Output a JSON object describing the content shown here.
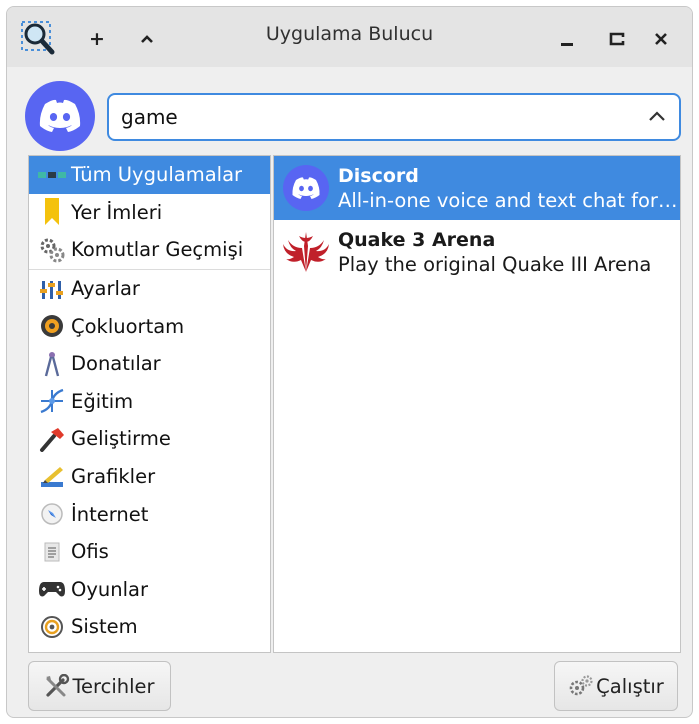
{
  "window": {
    "title": "Uygulama Bulucu",
    "new_label": "+",
    "collapse_label": "^",
    "minimize_label": "_",
    "maximize_label": "▭",
    "close_label": "✕"
  },
  "search": {
    "value": "game",
    "avatar_icon": "discord-icon",
    "toggle_icon": "chevron-up-icon"
  },
  "categories": [
    {
      "label": "Tüm Uygulamalar",
      "icon": "all-apps-icon",
      "selected": true
    },
    {
      "label": "Yer İmleri",
      "icon": "bookmark-icon"
    },
    {
      "label": "Komutlar Geçmişi",
      "icon": "gears-icon"
    },
    {
      "label": "Ayarlar",
      "icon": "sliders-icon"
    },
    {
      "label": "Çokluortam",
      "icon": "multimedia-icon"
    },
    {
      "label": "Donatılar",
      "icon": "compass-icon"
    },
    {
      "label": "Eğitim",
      "icon": "dna-icon"
    },
    {
      "label": "Geliştirme",
      "icon": "hammer-icon"
    },
    {
      "label": "Grafikler",
      "icon": "graphics-icon"
    },
    {
      "label": "İnternet",
      "icon": "globe-icon"
    },
    {
      "label": "Ofis",
      "icon": "document-icon"
    },
    {
      "label": "Oyunlar",
      "icon": "gamepad-icon"
    },
    {
      "label": "Sistem",
      "icon": "system-icon"
    }
  ],
  "results": [
    {
      "name": "Discord",
      "description": "All-in-one voice and text chat for gamers",
      "icon": "discord-icon",
      "selected": true
    },
    {
      "name": "Quake 3 Arena",
      "description": "Play the original Quake III Arena",
      "icon": "quake-icon"
    }
  ],
  "buttons": {
    "preferences": "Tercihler",
    "run": "Çalıştır"
  },
  "colors": {
    "accent": "#3f8ae0",
    "discord": "#5865f2",
    "quake": "#c0202a"
  }
}
